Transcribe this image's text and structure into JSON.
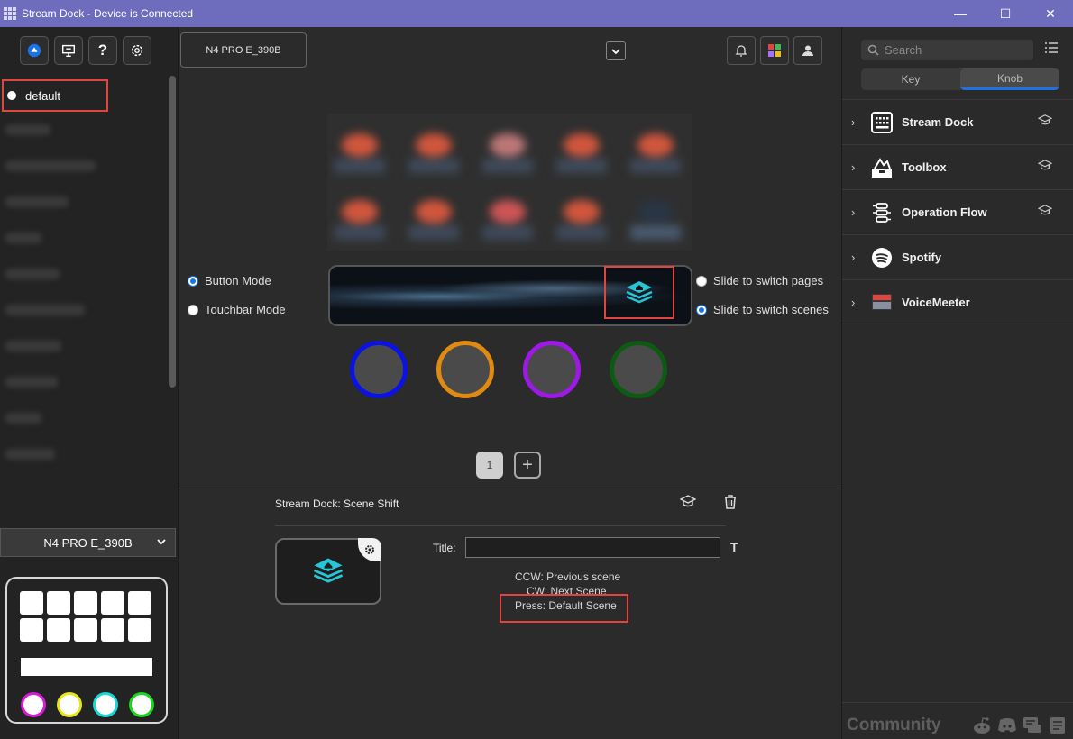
{
  "window": {
    "title": "Stream Dock - Device is Connected",
    "controls": {
      "minimize": "—",
      "maximize": "☐",
      "close": "✕"
    }
  },
  "left": {
    "toolbar": [
      "store-icon",
      "presentation-icon",
      "help-icon",
      "settings-icon"
    ],
    "help_glyph": "?",
    "profile": {
      "name": "default"
    },
    "device_select": {
      "value": "N4 PRO E_390B",
      "chevron": "⌄"
    }
  },
  "center": {
    "device_tab": "N4 PRO E_390B",
    "dropdown_glyph": "⌄",
    "modes": {
      "button": "Button Mode",
      "touchbar": "Touchbar Mode"
    },
    "slide": {
      "pages": "Slide to switch pages",
      "scenes": "Slide to switch scenes"
    },
    "knob_colors": [
      "#0a12e6",
      "#e08a12",
      "#9e18e6",
      "#0d5a12"
    ],
    "pages": {
      "current": "1",
      "add": "+"
    },
    "action": {
      "title": "Stream Dock: Scene Shift",
      "title_label": "Title:",
      "title_value": "",
      "t_glyph": "T",
      "ccw_label": "CCW:",
      "ccw_value": "Previous scene",
      "cw_label": "CW:",
      "cw_value": "Next Scene",
      "press_label": "Press:",
      "press_value": "Default Scene"
    }
  },
  "right": {
    "search_placeholder": "Search",
    "tabs": {
      "key": "Key",
      "knob": "Knob"
    },
    "plugins": [
      {
        "name": "Stream Dock",
        "icon": "grid-icon"
      },
      {
        "name": "Toolbox",
        "icon": "toolbox-icon"
      },
      {
        "name": "Operation Flow",
        "icon": "flow-icon"
      },
      {
        "name": "Spotify",
        "icon": "spotify-icon"
      },
      {
        "name": "VoiceMeeter",
        "icon": "voicemeeter-icon"
      }
    ],
    "community": "Community"
  },
  "colors": {
    "accent": "#1a73e8",
    "highlight": "#e0453f",
    "titlebar": "#6e6cbd"
  }
}
